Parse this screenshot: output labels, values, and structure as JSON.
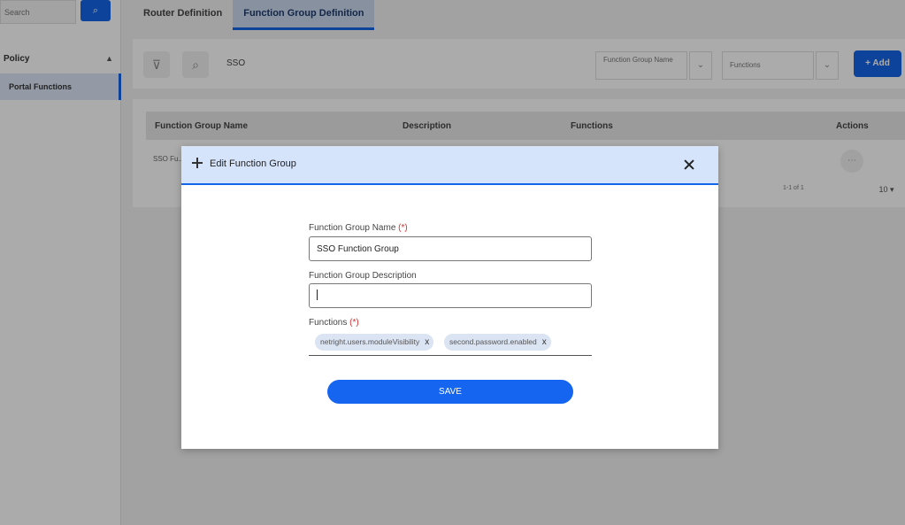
{
  "sidebar": {
    "search_text": "Search",
    "search_button_label": "⌕",
    "section_label": "Policy",
    "items": [
      {
        "label": "Portal Functions"
      }
    ]
  },
  "tabs": [
    {
      "label": "Router Definition"
    },
    {
      "label": "Function Group Definition"
    }
  ],
  "toolbar": {
    "search_text": "SSO",
    "filter1_label": "Function Group Name",
    "filter2_label": "Functions",
    "add_label": "Add"
  },
  "table": {
    "columns": [
      "Function Group Name",
      "Description",
      "Functions",
      "Actions"
    ],
    "rows": [
      [
        "SSO Fu..."
      ]
    ],
    "pagination_text": "1-1 of 1",
    "page_size": "10"
  },
  "modal": {
    "title": "Edit Function Group",
    "name_label": "Function Group Name",
    "required_marker": "(*)",
    "name_value": "SSO Function Group",
    "description_label": "Function Group Description",
    "description_value": "",
    "functions_label": "Functions",
    "functions": [
      {
        "label": "netright.users.moduleVisibility"
      },
      {
        "label": "second.password.enabled"
      }
    ],
    "chip_remove": "x",
    "save_label": "SAVE"
  },
  "colors": {
    "accent": "#1565e8",
    "modal_header": "#d6e4fb",
    "required": "#d32f2f",
    "chip": "#dbe4f3"
  },
  "icons": [
    "plus-icon",
    "close-icon",
    "filter-icon",
    "search-icon",
    "chevron-down-icon",
    "remove-chip-icon",
    "action-icon"
  ]
}
